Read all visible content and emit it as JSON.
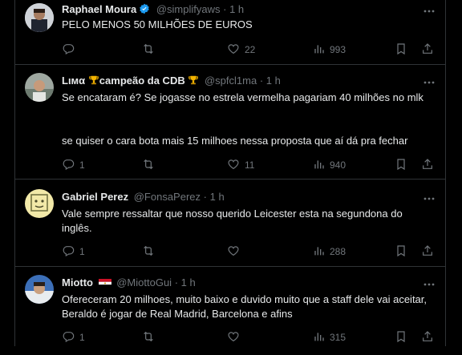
{
  "colors": {
    "background": "#000000",
    "text": "#e7e9ea",
    "muted": "#71767b",
    "verified": "#1d9bf0",
    "divider": "#2f3336"
  },
  "tweets": [
    {
      "name": "Raphael Moura",
      "handle": "@simplifyaws",
      "dot": "·",
      "time": "1 h",
      "text": "PELO MENOS 50 MILHÕES DE EUROS",
      "text2": "",
      "reply": "",
      "retweet": "",
      "like": "22",
      "views": "993"
    },
    {
      "name_prefix": "Lιмα",
      "name_main": "campeão da CDB",
      "handle": "@spfcl1ma",
      "dot": "·",
      "time": "1 h",
      "text": "Se encataram é? Se jogasse no estrela vermelha pagariam 40 milhões no mlk",
      "text2": "se quiser o cara bota mais 15 milhoes nessa proposta que aí dá pra fechar",
      "reply": "1",
      "retweet": "",
      "like": "11",
      "views": "940"
    },
    {
      "name": "Gabriel Perez",
      "handle": "@FonsaPerez",
      "dot": "·",
      "time": "1 h",
      "text": "Vale sempre ressaltar que nosso querido Leicester esta na segundona do inglês.",
      "text2": "",
      "reply": "1",
      "retweet": "",
      "like": "",
      "views": "288"
    },
    {
      "name": "Miotto",
      "handle": "@MiottoGui",
      "dot": "·",
      "time": "1 h",
      "text": "Ofereceram 20 milhoes, muito baixo e duvido muito que a staff dele vai aceitar, Beraldo é jogar de Real Madrid, Barcelona e afins",
      "text2": "",
      "reply": "1",
      "retweet": "",
      "like": "",
      "views": "315"
    }
  ],
  "icons": {
    "more": "more-dots-icon",
    "reply": "reply-icon",
    "retweet": "retweet-icon",
    "like": "heart-icon",
    "views": "views-icon",
    "bookmark": "bookmark-icon",
    "share": "share-icon",
    "verified": "verified-badge-icon",
    "trophy": "trophy-emoji",
    "flag": "flag-egypt"
  }
}
